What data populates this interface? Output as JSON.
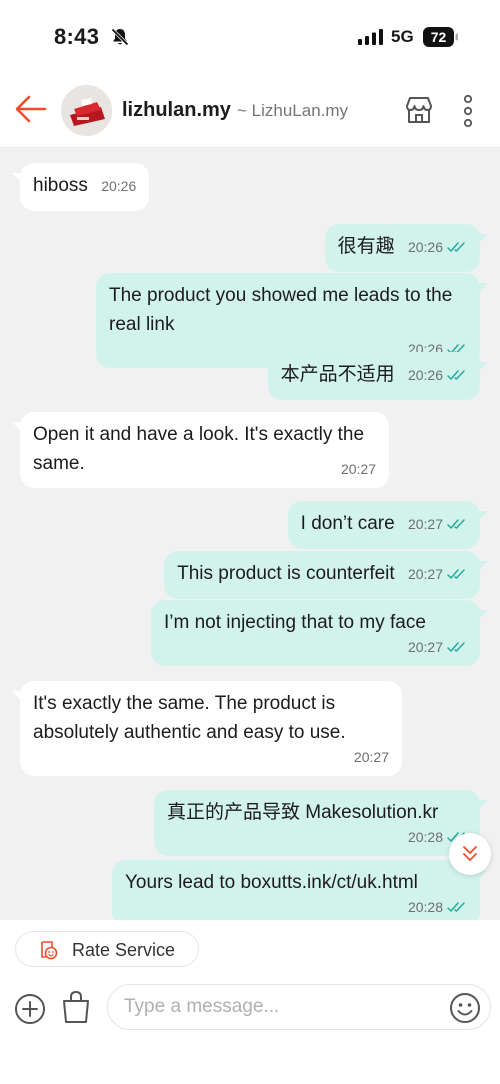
{
  "status": {
    "time": "8:43",
    "network": "5G",
    "battery": "72"
  },
  "header": {
    "shop_name": "lizhulan.my",
    "shop_sub": "~ LizhuLan.my"
  },
  "messages": [
    {
      "text": "hiboss",
      "time": "20:26"
    },
    {
      "text": "很有趣",
      "time": "20:26"
    },
    {
      "text": "The product you showed me leads to the real link",
      "time": "20:26"
    },
    {
      "text": "本产品不适用",
      "time": "20:26"
    },
    {
      "text": "Open it and have a look. It's exactly the same.",
      "time": "20:27"
    },
    {
      "text": "I don’t care",
      "time": "20:27"
    },
    {
      "text": "This product is counterfeit",
      "time": "20:27"
    },
    {
      "text": "I’m not injecting that to my face",
      "time": "20:27"
    },
    {
      "text": "It's exactly the same. The product is absolutely authentic and easy to use.",
      "time": "20:27"
    },
    {
      "text": "真正的产品导致 Makesolution.kr",
      "time": "20:28"
    },
    {
      "text": "Yours lead to boxutts.ink/ct/uk.html",
      "time": "20:28"
    }
  ],
  "footer": {
    "rate_label": "Rate Service",
    "input_placeholder": "Type a message..."
  },
  "colors": {
    "accent": "#ee4d2d",
    "outgoing_bubble": "#d2f3ec",
    "incoming_bubble": "#ffffff",
    "chat_bg": "#f1f1f1",
    "read_ticks": "#26aa99"
  }
}
